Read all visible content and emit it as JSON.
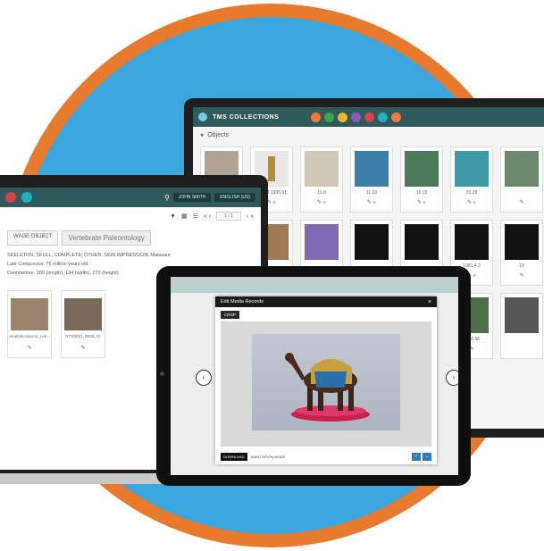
{
  "colors": {
    "ring": "#e87a2e",
    "background": "#3ba7de",
    "header": "#2f5a5c",
    "accent_blue": "#2c7cc4"
  },
  "desktop": {
    "app_title": "TMS COLLECTIONS",
    "section_title": "Objects",
    "nav_icons": [
      "home-icon",
      "add-icon",
      "star-icon",
      "list-icon",
      "bookmark-icon",
      "info-icon",
      "settings-icon"
    ],
    "row1_captions": [
      "",
      "EDAM.1995.91",
      "13.8",
      "11.16",
      "15.15",
      "20.28",
      ""
    ],
    "row2_captions": [
      "",
      "",
      "",
      "",
      "",
      "1981.4.3",
      "19"
    ],
    "row3_captions": [
      "",
      "",
      "",
      "",
      "",
      "2008.66",
      ""
    ]
  },
  "laptop": {
    "user_menu": "JOHN SMITH",
    "language_menu": "ENGLISH (US)",
    "pager": "1 / 1",
    "tab_small": "WAGE OBJECT",
    "tab_active": "Vertebrate Paleontology",
    "desc_lines": [
      "SKELETON, SKULL, COMPLETE; OTHER: SKIN IMPRESSION; Maiasaur",
      "Late Cretaceous, 76 million years old",
      "Centimetres: 300 (length), 134 (width), 270 (height)"
    ],
    "thumb_captions": [
      "Amphibiosaurus_Lee...",
      "RO10001_0008_22"
    ]
  },
  "tablet": {
    "modal_title": "Edit Media Records",
    "crop_label": "CROP",
    "download_label": "DOWNLOAD",
    "annotation_label": "ANNOTATION MODE"
  }
}
